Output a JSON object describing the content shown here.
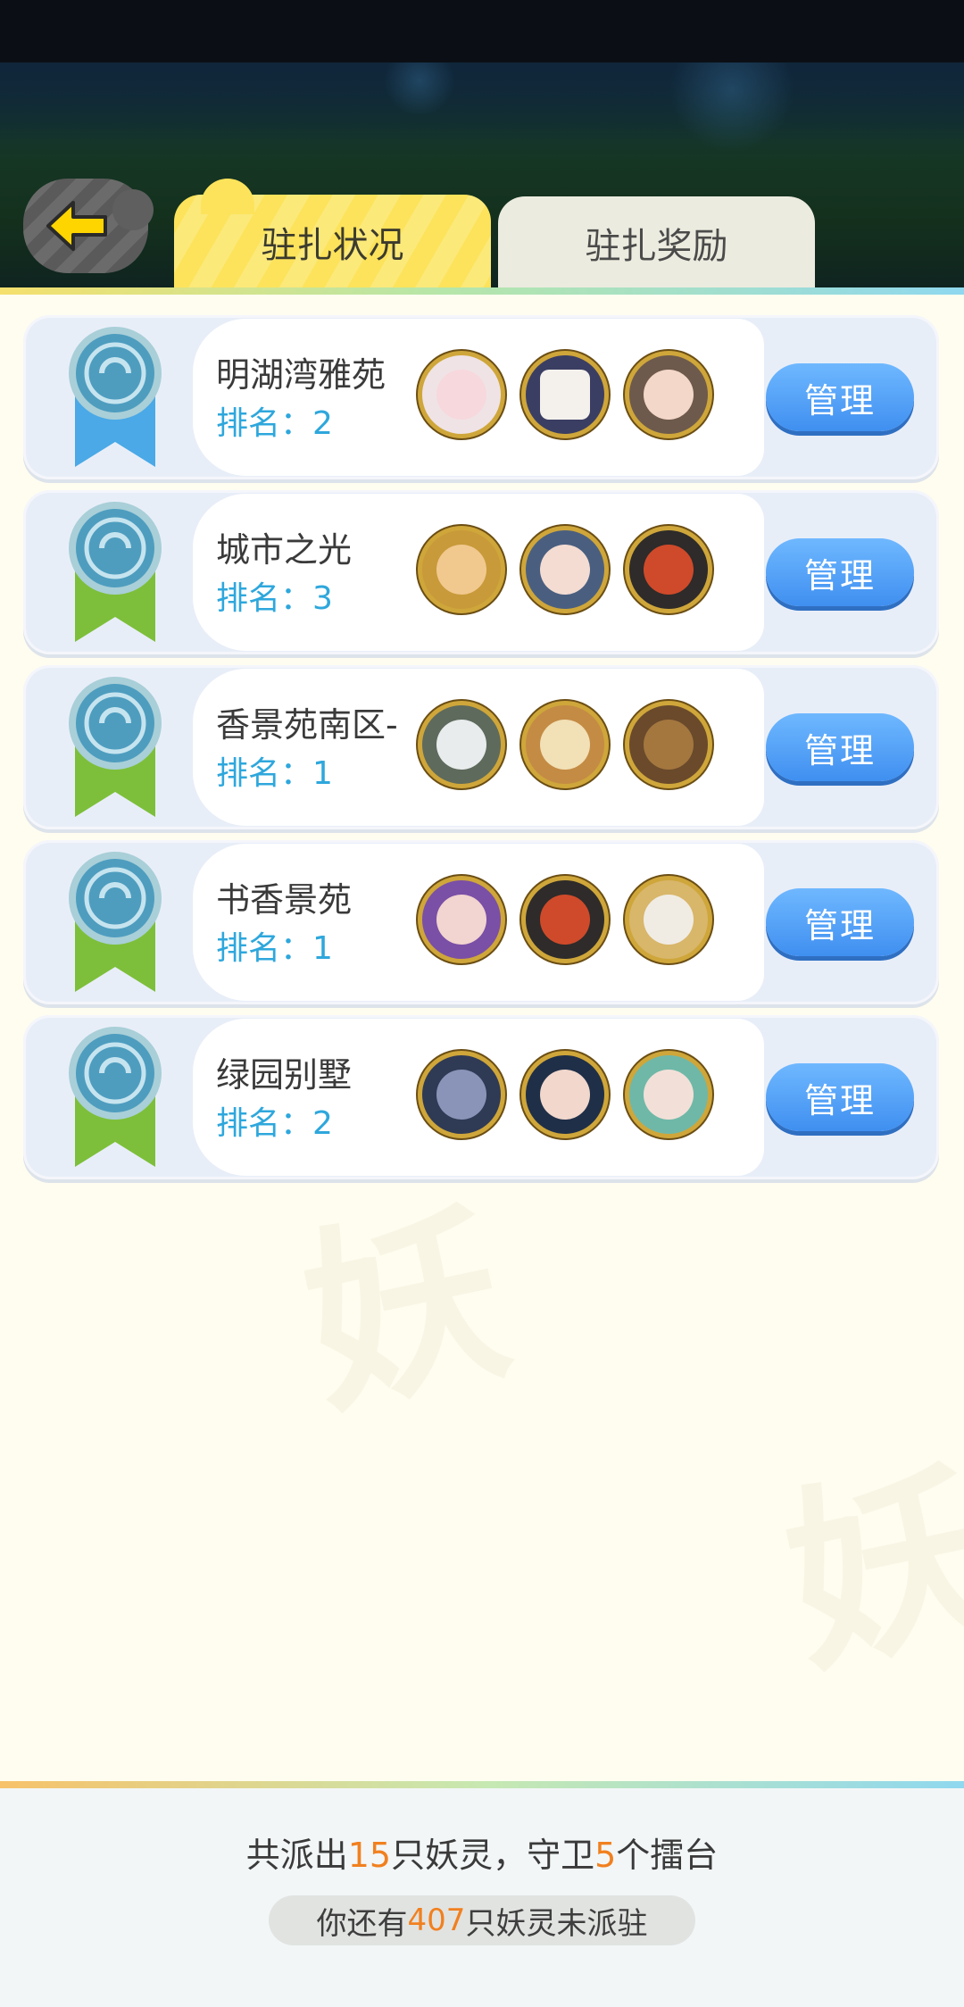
{
  "header": {
    "back_icon": "back-arrow-icon",
    "tabs": [
      {
        "label": "驻扎状况",
        "active": true
      },
      {
        "label": "驻扎奖励",
        "active": false
      }
    ]
  },
  "colors": {
    "accent_yellow": "#fde35b",
    "button_blue": "#4a9af4",
    "rank_blue": "#2ea7dc",
    "highlight_orange": "#f1801f",
    "medal_blue": "#4aa9e6",
    "medal_green": "#7dbf3a"
  },
  "stations": [
    {
      "name": "明湖湾雅苑",
      "rank_label": "排名：",
      "rank": "2",
      "medal": "blue",
      "avatars": [
        "white-hair-girl-avatar",
        "dice-avatar",
        "cat-ear-girl-avatar"
      ],
      "button": "管理"
    },
    {
      "name": "城市之光",
      "rank_label": "排名：",
      "rank": "3",
      "medal": "green",
      "avatars": [
        "golden-helmet-avatar",
        "wolf-girl-avatar",
        "red-demon-avatar"
      ],
      "button": "管理"
    },
    {
      "name": "香景苑南区-",
      "rank_label": "排名：",
      "rank": "1",
      "medal": "green",
      "avatars": [
        "silver-hair-girl-avatar",
        "sprout-girl-avatar",
        "stone-golem-avatar"
      ],
      "button": "管理"
    },
    {
      "name": "书香景苑",
      "rank_label": "排名：",
      "rank": "1",
      "medal": "green",
      "avatars": [
        "purple-hair-girl-avatar",
        "red-demon-avatar",
        "white-elephant-avatar"
      ],
      "button": "管理"
    },
    {
      "name": "绿园别墅",
      "rank_label": "排名：",
      "rank": "2",
      "medal": "green",
      "avatars": [
        "blue-monk-avatar",
        "blue-bow-girl-avatar",
        "teal-hair-girl-avatar"
      ],
      "button": "管理"
    }
  ],
  "footer": {
    "summary_prefix": "共派出",
    "summary_count": "15",
    "summary_mid": "只妖灵，守卫",
    "summary_platforms": "5",
    "summary_suffix": "个擂台",
    "pill_prefix": "你还有",
    "pill_count": "407",
    "pill_suffix": "只妖灵未派驻"
  }
}
